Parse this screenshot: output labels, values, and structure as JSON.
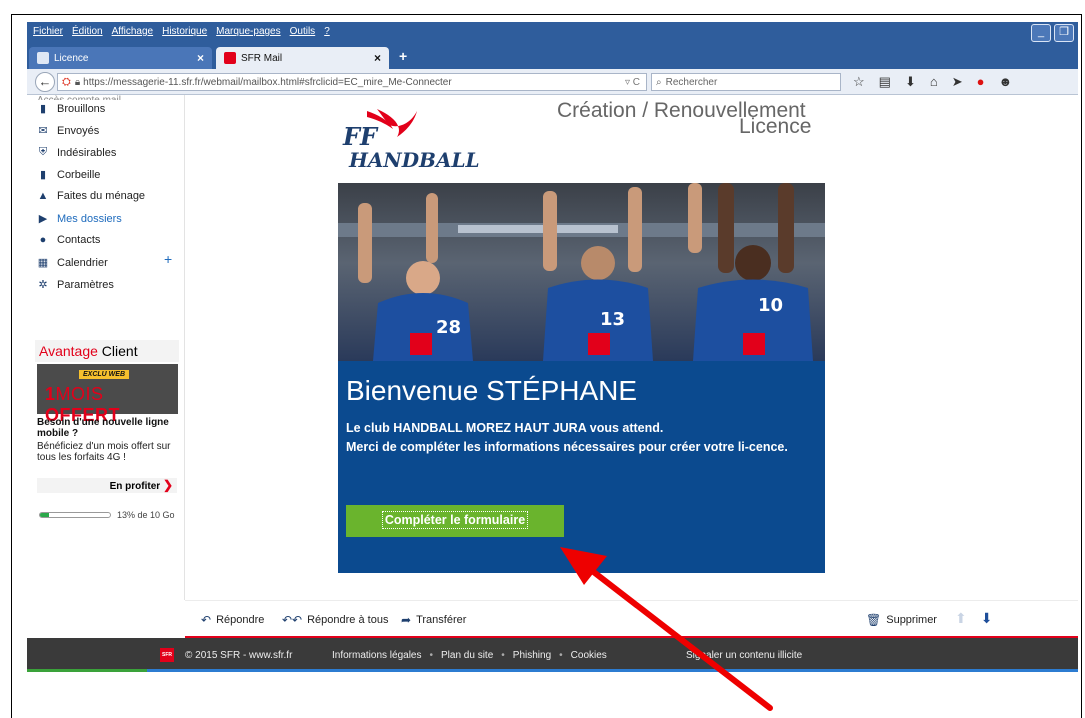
{
  "menubar": {
    "items": [
      "Fichier",
      "Édition",
      "Affichage",
      "Historique",
      "Marque-pages",
      "Outils",
      "?"
    ]
  },
  "tabs": [
    {
      "label": "Licence"
    },
    {
      "label": "SFR Mail"
    }
  ],
  "navbar": {
    "url": "https://messagerie-11.sfr.fr/webmail/mailbox.html#sfrclicid=EC_mire_Me-Connecter",
    "search_placeholder": "Rechercher"
  },
  "sidebar": {
    "items": [
      {
        "label": "Brouillons",
        "icon": "draft-icon"
      },
      {
        "label": "Envoyés",
        "icon": "sent-icon"
      },
      {
        "label": "Indésirables",
        "icon": "spam-shield-icon"
      },
      {
        "label": "Corbeille",
        "icon": "trash-icon"
      },
      {
        "label": "Faites du ménage",
        "icon": "broom-icon"
      },
      {
        "label": "Mes dossiers",
        "icon": "folder-toggle-icon"
      },
      {
        "label": "Contacts",
        "icon": "contacts-icon"
      },
      {
        "label": "Calendrier",
        "icon": "calendar-icon"
      },
      {
        "label": "Paramètres",
        "icon": "gear-icon"
      }
    ],
    "ad": {
      "header_red": "Avantage",
      "header_black": "Client",
      "badge": "EXCLU WEB",
      "offer_num": "1",
      "offer_thin": "MOIS",
      "offer_bold": "OFFERT",
      "title": "Besoin d'une nouvelle ligne mobile ?",
      "desc": "Bénéficiez d'un mois offert sur tous les forfaits 4G !",
      "cta": "En profiter"
    },
    "quota": {
      "label": "13% de 10 Go",
      "percent": 13
    }
  },
  "email": {
    "brand_line1": "FF",
    "brand_line2": "HANDBALL",
    "header_title": "Création / Renouvellement",
    "header_sub": "Licence",
    "welcome": "Bienvenue STÉPHANE",
    "p1": "Le club HANDBALL MOREZ HAUT JURA vous attend.",
    "p2": "Merci de compléter les informations nécessaires pour créer votre li-cence.",
    "button": "Compléter le formulaire"
  },
  "actions": {
    "reply": "Répondre",
    "reply_all": "Répondre à tous",
    "forward": "Transférer",
    "delete": "Supprimer"
  },
  "footer": {
    "sfr_badge": "SFR",
    "copyright": "© 2015 SFR - www.sfr.fr",
    "links": [
      "Informations légales",
      "Plan du site",
      "Phishing",
      "Cookies"
    ],
    "signal": "Signaler un contenu illicite"
  },
  "colors": {
    "sfr_red": "#e2001a",
    "email_blue": "#0b4a8f",
    "cta_green": "#6ab42d",
    "annotation_arrow": "#ee0000"
  }
}
